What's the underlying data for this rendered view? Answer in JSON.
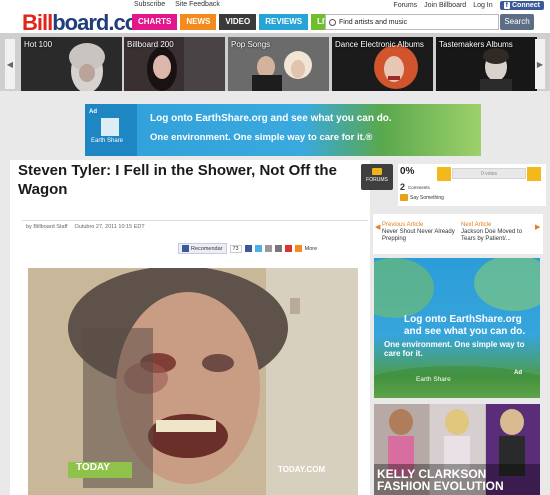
{
  "header": {
    "logo_part1": "Bill",
    "logo_part2": "board.com",
    "utility_links": [
      "Subscribe",
      "Site Feedback"
    ],
    "account_links": [
      "Forums",
      "Join Billboard",
      "Log In"
    ],
    "connect_label": "Connect",
    "tabs": [
      {
        "label": "CHARTS",
        "color": "#e4168b"
      },
      {
        "label": "NEWS",
        "color": "#f58b1f"
      },
      {
        "label": "VIDEO",
        "color": "#3a3a3a"
      },
      {
        "label": "REVIEWS",
        "color": "#27a4d6"
      },
      {
        "label": "LIVE",
        "color": "#6fbe2d"
      }
    ],
    "search_placeholder": "Find artists and music",
    "search_button": "Search"
  },
  "carousel": {
    "items": [
      "Hot 100",
      "Billboard 200",
      "Pop Songs",
      "Dance Electronic Albums",
      "Tastemakers Albums"
    ]
  },
  "ad_top": {
    "line1": "Log onto EarthShare.org and see what you can do.",
    "line2": "One environment. One simple way to care for it.®",
    "adcouncil": "Ad",
    "earthshare": "Earth Share"
  },
  "article": {
    "headline": "Steven Tyler: I Fell in the Shower, Not Off the Wagon",
    "forums_label": "FORUMS",
    "byline": "by Billboard Staff",
    "date": "Outubro 27, 2011 10:15 EDT",
    "recommend_label": "Recomendar",
    "recommend_count": "73",
    "more_label": "More",
    "photo_brand": "TODAY",
    "photo_url": "TODAY.COM"
  },
  "rating": {
    "percent": "0%",
    "bar_label": "0 votes",
    "comments_count": "2",
    "comments_label": "Comments",
    "saying_label": "Say Something"
  },
  "sidebar": {
    "prev_label": "Previous Article",
    "prev_title": "Never Shout Never Already Prepping",
    "next_label": "Next Article",
    "next_title": "Jackson Doe Moved to Tears by Patient/...",
    "ad_line1": "Log onto EarthShare.org and see what you can do.",
    "ad_line2": "One environment. One simple way to care for it.",
    "ad_earthshare": "Earth Share",
    "ad_adcouncil": "Ad",
    "promo_title": "KELLY CLARKSON FASHION EVOLUTION"
  }
}
